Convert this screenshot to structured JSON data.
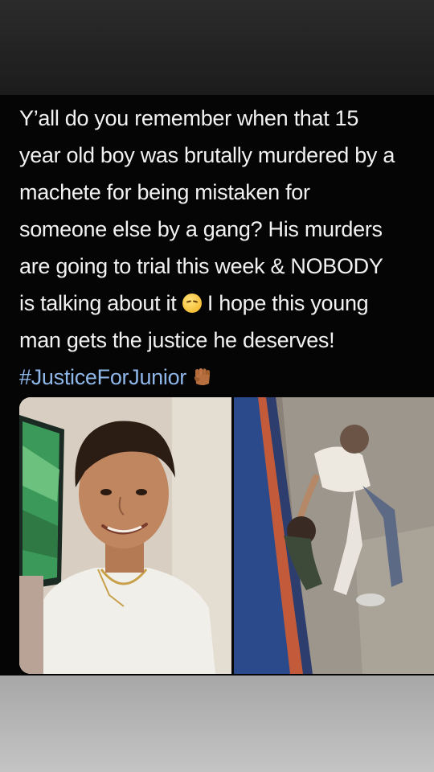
{
  "post": {
    "text_lines": [
      "Y’all do you remember when that 15",
      "year old boy was brutally murdered by a",
      "machete for being mistaken for",
      "someone else by a gang? His murders",
      "are going to trial this week & NOBODY",
      "is talking about it",
      "I hope this young",
      "man gets the justice he deserves!"
    ],
    "hashtag": "#JusticeForJunior",
    "emojis": [
      "sad-face",
      "raised-fist"
    ]
  },
  "photos": [
    {
      "name": "portrait-photo",
      "subject": "smiling young man"
    },
    {
      "name": "cctv-photo",
      "subject": "surveillance still"
    }
  ],
  "colors": {
    "text": "#f2f2f2",
    "hashtag": "#8fb6e8",
    "background": "#050505",
    "top_band": "#2b2b2b",
    "bottom_band": "#b8b8b8"
  }
}
